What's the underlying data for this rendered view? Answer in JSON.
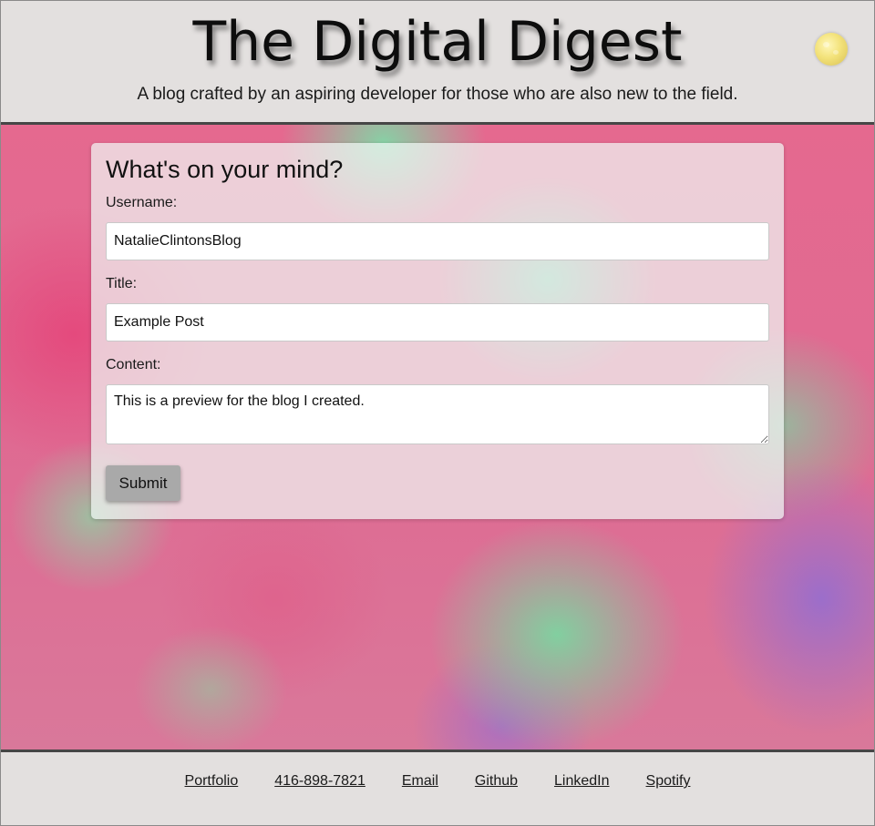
{
  "header": {
    "title": "The Digital Digest",
    "tagline": "A blog crafted by an aspiring developer for those who are also new to the field.",
    "theme_toggle_icon": "moon-icon"
  },
  "form": {
    "heading": "What's on your mind?",
    "username_label": "Username:",
    "username_value": "NatalieClintonsBlog",
    "title_label": "Title:",
    "title_value": "Example Post",
    "content_label": "Content:",
    "content_value": "This is a preview for the blog I created.",
    "submit_label": "Submit"
  },
  "footer": {
    "links": [
      "Portfolio",
      "416-898-7821",
      "Email",
      "Github",
      "LinkedIn",
      "Spotify"
    ]
  },
  "colors": {
    "header_bg": "#e3e0df",
    "border": "#464646",
    "button_bg": "#a9a9a9",
    "accent_pink": "#e4487c",
    "accent_green": "#82d6a6",
    "accent_purple": "#986ecd"
  }
}
